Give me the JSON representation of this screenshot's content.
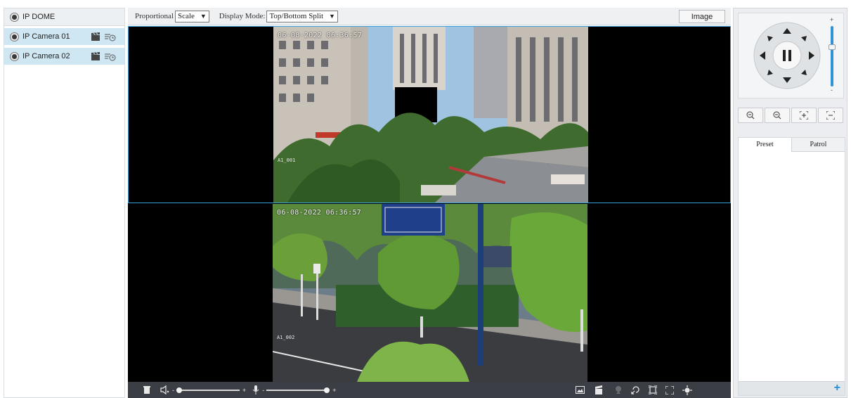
{
  "device_tree": {
    "root_label": "IP DOME",
    "cameras": [
      {
        "label": "IP Camera 01"
      },
      {
        "label": "IP Camera 02"
      }
    ]
  },
  "toolbar": {
    "proportional_label": "Proportional",
    "proportional_value": "Scale",
    "display_mode_label": "Display Mode:",
    "display_mode_value": "Top/Bottom Split",
    "image_button": "Image"
  },
  "video": {
    "top_timestamp": "06-08-2022 06:36:57",
    "bottom_timestamp": "06-08-2022 06:36:57",
    "top_overlay_small": "A1_001",
    "bottom_overlay_small": "A1_002"
  },
  "ptz": {
    "tabs": [
      {
        "label": "Preset"
      },
      {
        "label": "Patrol"
      }
    ],
    "add_button": "+",
    "speed_plus": "+",
    "speed_minus": "-"
  },
  "controls": {
    "volume_minus": "-",
    "volume_plus": "+",
    "volume_level": 0.0,
    "mic_minus": "-",
    "mic_plus": "+",
    "mic_level": 1.0
  },
  "colors": {
    "selection_bg": "#cfe7f3",
    "video_bg": "#000000",
    "control_bar_bg": "#3b3e44",
    "accent_blue": "#1e8fd8",
    "split_line": "#3aa0d8"
  }
}
